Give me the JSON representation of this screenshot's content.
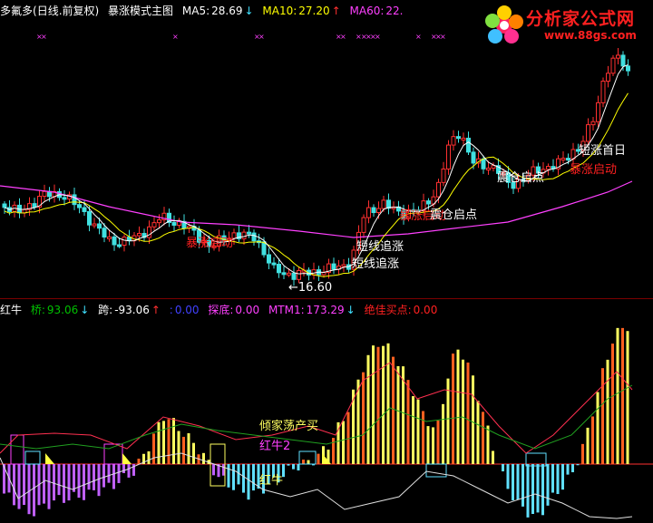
{
  "main_title": {
    "name": "多氟多",
    "period": "(日线.前复权)",
    "formula": "暴涨模式主图"
  },
  "ma": [
    {
      "label": "MA5:",
      "value": "28.69",
      "arrow": "↓",
      "color": "#ffffff"
    },
    {
      "label": "MA10:",
      "value": "27.20",
      "arrow": "↑",
      "color": "#ffff00"
    },
    {
      "label": "MA60:",
      "value": "22.",
      "arrow": "",
      "color": "#ff40ff"
    }
  ],
  "price_annotations": {
    "low": "16.60",
    "short_chase_1": "短线追涨",
    "short_chase_2": "短线追涨",
    "rally_start_1": "暴涨启动",
    "rally_start_2": "暴涨启动",
    "rally_start_3": "暴涨启动",
    "heavy_start_1": "震仓启点",
    "heavy_start_2": "震仓启点",
    "first_day": "短涨首日"
  },
  "indicator_bar": {
    "name": "红牛",
    "qiao": {
      "label": "桥:",
      "value": "93.06",
      "arrow": "↓",
      "color": "#00c000"
    },
    "kua": {
      "label": "跨:",
      "value": "-93.06",
      "arrow": "↑",
      "color": "#ffffff"
    },
    "colon": {
      "label": ":",
      "value": "0.00",
      "color": "#4040ff"
    },
    "tandi": {
      "label": "探底:",
      "value": "0.00",
      "color": "#ff40ff"
    },
    "mtm": {
      "label": "MTM1:",
      "value": "173.29",
      "arrow": "↓",
      "color": "#ff40ff"
    },
    "jiajia": {
      "label": "绝佳买点:",
      "value": "0.00",
      "color": "#ff2020"
    }
  },
  "indicator_annotations": {
    "qingjia": "倾家荡产买",
    "hongniu2": "红牛2",
    "hongniu": "红牛"
  },
  "logo": {
    "line1": "分析家公式网",
    "line2": "www.88gs.com"
  },
  "colors": {
    "up": "#ff3030",
    "down": "#40e0e0",
    "ma5": "#ffffff",
    "ma10": "#ffff00",
    "ma60": "#ff40ff",
    "bar_yellow": "#ffff60",
    "bar_orange": "#ff6020",
    "bar_purple": "#c060ff",
    "bar_cyan": "#60e0ff"
  }
}
